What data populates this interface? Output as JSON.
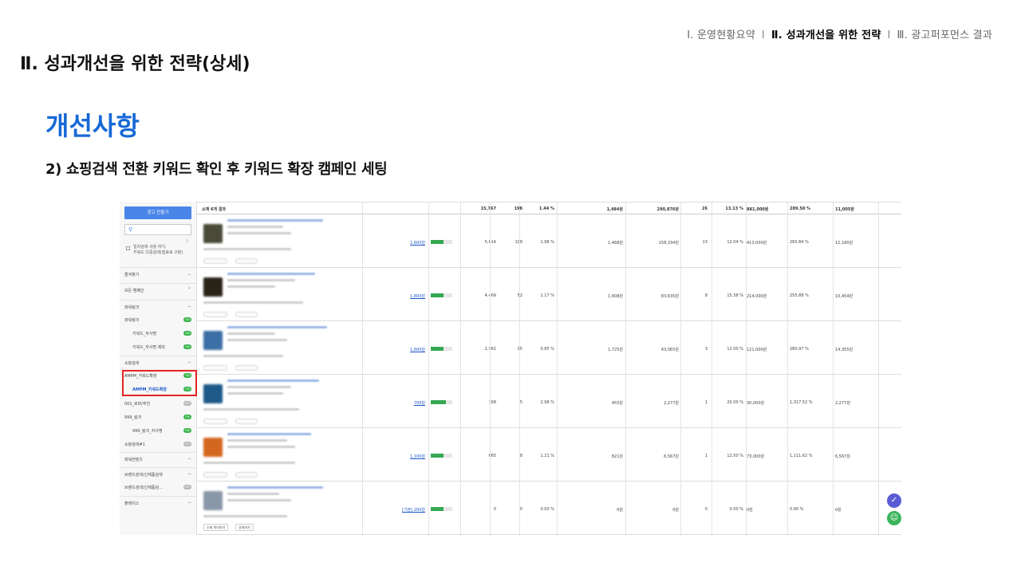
{
  "nav": {
    "item1": "Ⅰ. 운영현황요약",
    "item2": "Ⅱ. 성과개선을 위한 전략",
    "item3": "Ⅲ. 광고퍼포먼스 결과",
    "separator": "I"
  },
  "page_title": "Ⅱ. 성과개선을 위한 전략(상세)",
  "section_title": "개선사항",
  "subtitle": "2) 쇼핑검색 전환 키워드 확인 후 키워드 확장 캠페인 세팅",
  "sidebar": {
    "create_button": "광고 만들기",
    "search_icon": "search-icon",
    "help_icon": "?",
    "option_text": "일치검색 사용 하기,\n키워드 다중검색(쉼표로 구분)",
    "favorites": {
      "label": "즐겨찾기",
      "chevron": "⌄"
    },
    "all_campaigns": {
      "label": "모든 캠페인",
      "chevron": "⌃"
    },
    "campaigns": [
      {
        "label": "파워링크",
        "ctl": "−",
        "type": "group"
      },
      {
        "label": "파워링크",
        "toggle": "ON",
        "type": "item"
      },
      {
        "label": "키워드_자사명",
        "toggle": "ON",
        "type": "sub"
      },
      {
        "label": "키워드_자사명 제외",
        "toggle": "ON",
        "type": "sub"
      },
      {
        "label": "쇼핑검색",
        "ctl": "−",
        "type": "group"
      },
      {
        "label": "AMPM_키워드확장",
        "toggle": "ON",
        "type": "item"
      },
      {
        "label": "AMPM_키워드확장",
        "toggle": "ON",
        "type": "sub",
        "active": true
      },
      {
        "label": "001_로퍼/추천",
        "toggle": "OFF",
        "type": "item"
      },
      {
        "label": "999_링크",
        "toggle": "ON",
        "type": "item"
      },
      {
        "label": "999_링크_자사명",
        "toggle": "ON",
        "type": "sub"
      },
      {
        "label": "쇼핑검색#1",
        "toggle": "OFF",
        "type": "item"
      },
      {
        "label": "파워컨텐츠",
        "ctl": "−",
        "type": "group"
      },
      {
        "label": "브랜드검색/신제품검색",
        "ctl": "−",
        "type": "group"
      },
      {
        "label": "브랜드검색/신제품검…",
        "toggle": "OFF",
        "type": "item"
      },
      {
        "label": "플레이스",
        "ctl": "−",
        "type": "group"
      }
    ]
  },
  "table": {
    "header_label": "소재 6개 결과",
    "totals": [
      "15,767",
      "198",
      "1.44 %",
      "1,484원",
      "290,876원",
      "26",
      "13.13 %",
      "881,000원",
      "289.58 %",
      "11,005원"
    ],
    "rows": [
      {
        "price": "1,600원",
        "bars": 0.6,
        "c1": "5,614",
        "c2": "108",
        "c3": "1.98 %",
        "c4": "1,468원",
        "c5": "158,334원",
        "c6": "13",
        "c7": "12.04 %",
        "c8": "413,000원",
        "c9": "260.84 %",
        "c10": "12,180원",
        "thumb": "#4a4a3a"
      },
      {
        "price": "1,800원",
        "bars": 0.6,
        "c1": "4,469",
        "c2": "52",
        "c3": "1.17 %",
        "c4": "1,608원",
        "c5": "83,635원",
        "c6": "8",
        "c7": "15.38 %",
        "c8": "214,000원",
        "c9": "255.88 %",
        "c10": "10,454원",
        "thumb": "#2a2418"
      },
      {
        "price": "1,600원",
        "bars": 0.6,
        "c1": "2,962",
        "c2": "25",
        "c3": "0.85 %",
        "c4": "1,725원",
        "c5": "43,065원",
        "c6": "3",
        "c7": "12.00 %",
        "c8": "121,000원",
        "c9": "280.97 %",
        "c10": "14,355원",
        "thumb": "#3d6fa6"
      },
      {
        "price": "700원",
        "bars": 0.7,
        "c1": "168",
        "c2": "5",
        "c3": "2.98 %",
        "c4": "455원",
        "c5": "2,277원",
        "c6": "1",
        "c7": "20.00 %",
        "c8": "30,000원",
        "c9": "1,317.52 %",
        "c10": "2,277원",
        "thumb": "#1d5a8a"
      },
      {
        "price": "1,100원",
        "bars": 0.6,
        "c1": "665",
        "c2": "8",
        "c3": "1.21 %",
        "c4": "821원",
        "c5": "6,567원",
        "c6": "1",
        "c7": "12.50 %",
        "c8": "73,000원",
        "c9": "1,111.62 %",
        "c10": "6,567원",
        "thumb": "#d4671f"
      },
      {
        "price": "[기본] 200원",
        "bars": 0.6,
        "c1": "0",
        "c2": "0",
        "c3": "0.00 %",
        "c4": "0원",
        "c5": "0원",
        "c6": "0",
        "c7": "0.00 %",
        "c8": "0원",
        "c9": "0.00 %",
        "c10": "0원",
        "thumb": "#8a97a8"
      }
    ],
    "footer_buttons": [
      "소재 미리보기",
      "상세보기"
    ]
  },
  "app_icons": {
    "check": "✓",
    "face": "☺",
    "check_color": "#5b5bd6",
    "face_color": "#3cb55a"
  },
  "colors": {
    "accent": "#1669d6",
    "on_toggle": "#38b54a",
    "highlight": "#e32222"
  }
}
